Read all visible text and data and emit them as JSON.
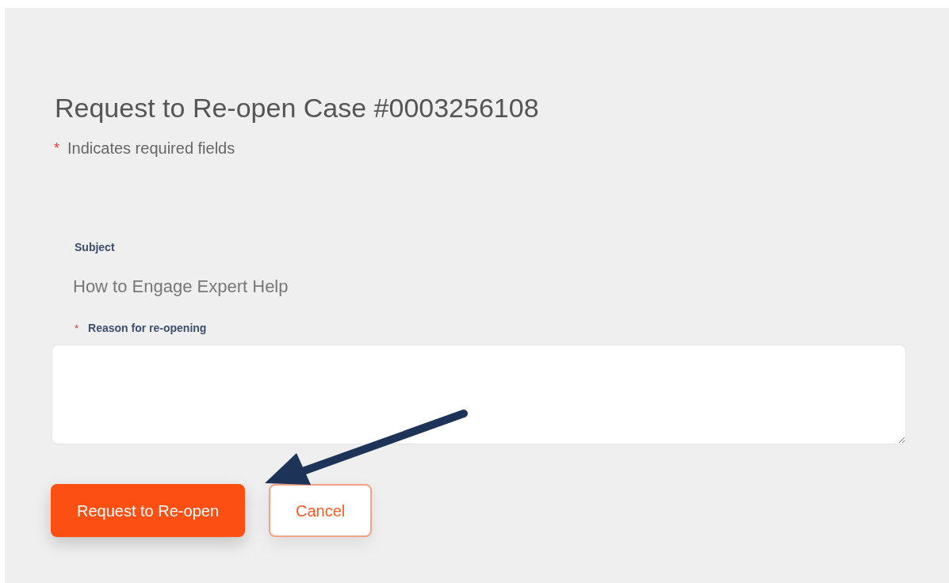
{
  "title": "Request to Re-open Case #0003256108",
  "required_note": {
    "marker": "*",
    "text": "Indicates required fields"
  },
  "fields": [
    {
      "kind": "readonly",
      "label": "Subject",
      "required": false,
      "value": "How to Engage Expert Help"
    },
    {
      "kind": "textarea",
      "label": "Reason for re-opening",
      "required": true,
      "marker": "*"
    }
  ],
  "buttons": [
    {
      "label": "Request to Re-open",
      "kind": "primary"
    },
    {
      "label": "Cancel",
      "kind": "secondary"
    }
  ]
}
